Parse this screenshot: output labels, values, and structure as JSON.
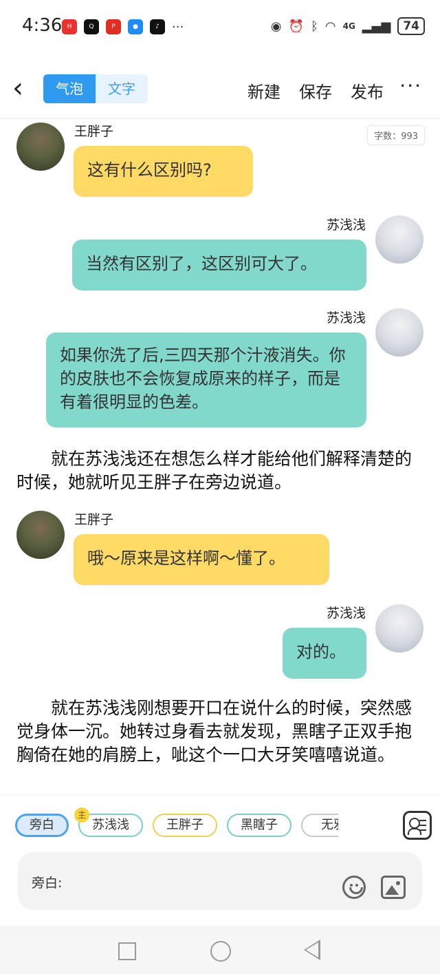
{
  "status": {
    "time": "4:36",
    "app_icons": [
      "huawei-appgallery-icon",
      "qq-icon",
      "pinduoduo-icon",
      "messages-icon",
      "tiktok-icon"
    ],
    "more": "···",
    "network": "4G",
    "battery": "74"
  },
  "header": {
    "mode_bubble": "气泡",
    "mode_text": "文字",
    "new_label": "新建",
    "save_label": "保存",
    "publish_label": "发布",
    "more_label": "···"
  },
  "word_count": "字数：993",
  "messages": [
    {
      "speaker": "王胖子",
      "text": "这有什么区别吗?",
      "side": "left",
      "color": "#fdd965"
    },
    {
      "speaker": "苏浅浅",
      "text": "当然有区别了，这区别可大了。",
      "side": "right",
      "color": "#82d8cb"
    },
    {
      "speaker": "苏浅浅",
      "text": "如果你洗了后,三四天那个汁液消失。你的皮肤也不会恢复成原来的样子，而是有着很明显的色差。",
      "side": "right",
      "color": "#82d8cb"
    },
    {
      "speaker": "王胖子",
      "text": "哦～原来是这样啊～懂了。",
      "side": "left",
      "color": "#fdd965"
    },
    {
      "speaker": "苏浅浅",
      "text": "对的。",
      "side": "right",
      "color": "#82d8cb"
    }
  ],
  "narrations": [
    "　　就在苏浅浅还在想怎么样才能给他们解释清楚的时候，她就听见王胖子在旁边说道。",
    "　　就在苏浅浅刚想要开口在说什么的时候，突然感觉身体一沉。她转过身看去就发现，黑瞎子正双手抱胸倚在她的肩膀上，呲这个一口大牙笑嘻嘻说道。"
  ],
  "characters": [
    {
      "label": "旁白"
    },
    {
      "label": "苏浅浅",
      "badge": "主"
    },
    {
      "label": "王胖子"
    },
    {
      "label": "黑瞎子"
    },
    {
      "label": "无邪"
    }
  ],
  "input": {
    "label": "旁白:"
  }
}
